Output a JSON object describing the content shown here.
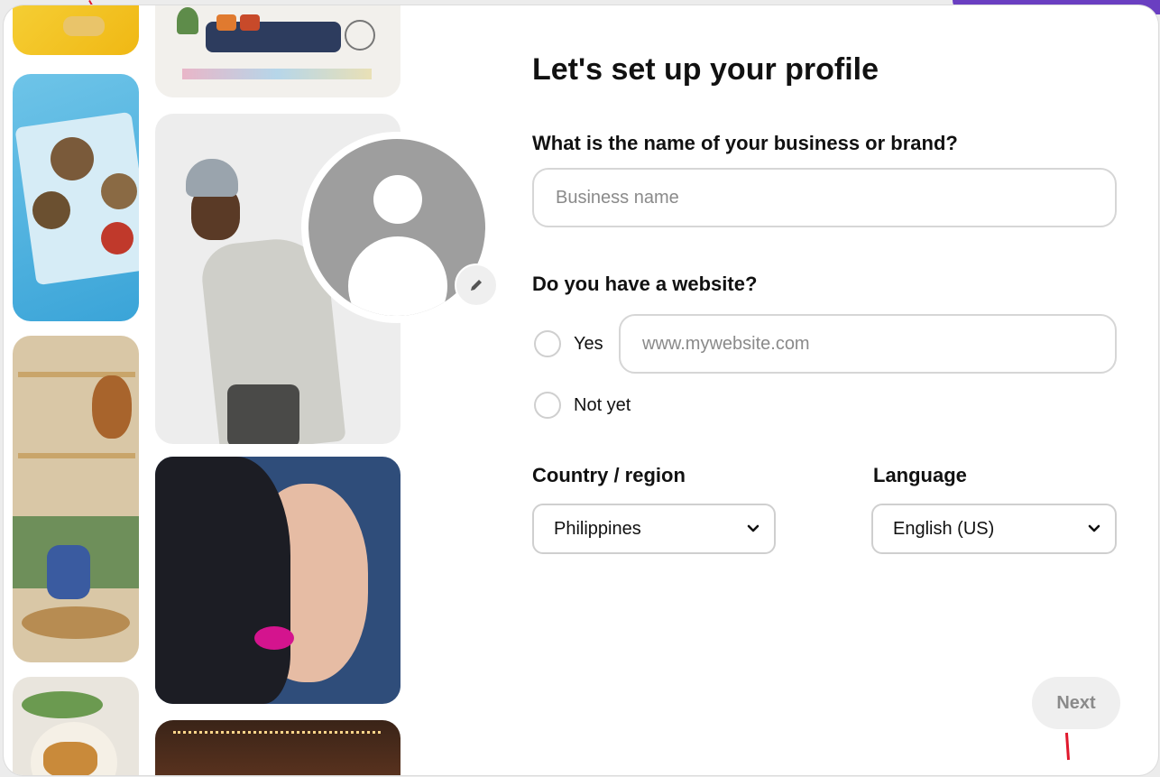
{
  "page": {
    "title": "Let's set up your profile"
  },
  "business": {
    "question": "What is the name of your business or brand?",
    "placeholder": "Business name",
    "value": ""
  },
  "website": {
    "question": "Do you have a website?",
    "yes_label": "Yes",
    "url_placeholder": "www.mywebsite.com",
    "not_yet_label": "Not yet"
  },
  "country": {
    "label": "Country / region",
    "selected": "Philippines"
  },
  "language": {
    "label": "Language",
    "selected": "English (US)"
  },
  "actions": {
    "next_label": "Next"
  },
  "icons": {
    "edit": "pencil-icon",
    "dropdown": "chevron-down-icon",
    "avatar": "default-avatar-icon"
  },
  "colors": {
    "accent": "#6a3fc1",
    "annotation": "#e0182c",
    "next_disabled_bg": "#efefef"
  }
}
